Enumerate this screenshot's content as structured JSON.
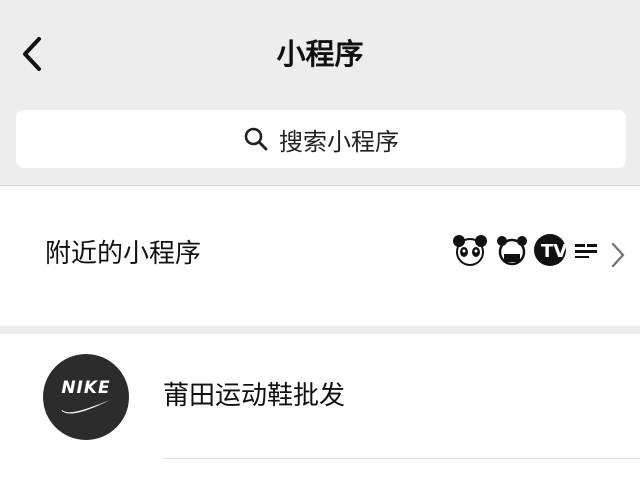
{
  "header": {
    "title": "小程序"
  },
  "search": {
    "placeholder": "搜索小程序"
  },
  "nearby": {
    "label": "附近的小程序",
    "logo_names": [
      "panda-logo",
      "bear-logo",
      "tv-logo",
      "brand-text-logo"
    ]
  },
  "list": {
    "items": [
      {
        "name": "莆田运动鞋批发",
        "avatar_text": "NIKE",
        "avatar_icon": "swoosh-icon"
      }
    ]
  },
  "colors": {
    "background": "#efefef",
    "card": "#ffffff",
    "avatar": "#2c2c2c",
    "text": "#111111"
  }
}
